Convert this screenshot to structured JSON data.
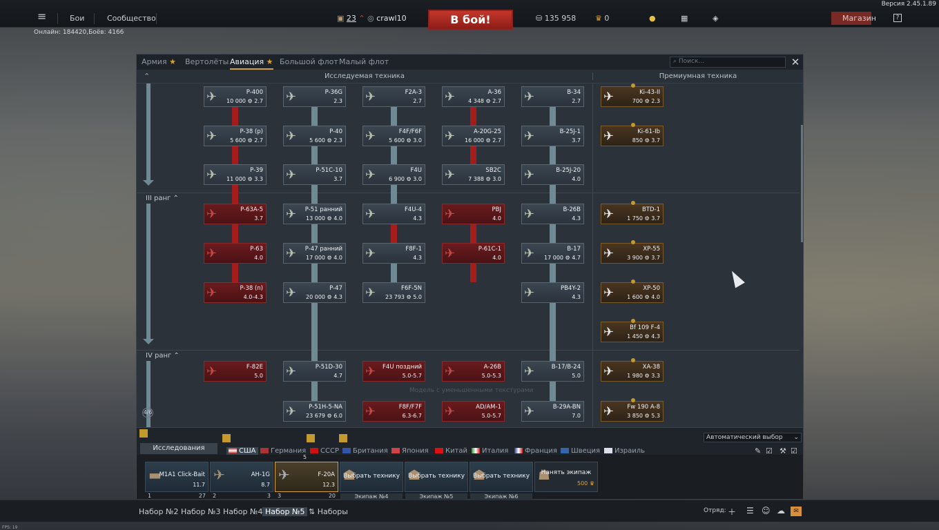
{
  "version": "Версия 2.45.1.89",
  "online": "Онлайн: 184420,Боёв: 4166",
  "fps": "FPS: 19",
  "topbar": {
    "menu": "≡",
    "battles": "Бои",
    "community": "Сообщество",
    "level": "23",
    "player": "crawl10",
    "battle_btn": "В бой!",
    "silver": "135 958",
    "gold": "0",
    "shop": "Магазин",
    "help": "?"
  },
  "tabs": [
    {
      "label": "Армия",
      "star": true
    },
    {
      "label": "Вертолёты",
      "star": false
    },
    {
      "label": "Авиация",
      "star": true,
      "active": true
    },
    {
      "label": "Большой флот",
      "star": false
    },
    {
      "label": "Малый флот",
      "star": false
    }
  ],
  "search_placeholder": "Поиск...",
  "close": "✕",
  "header": {
    "researched": "Исследуемая техника",
    "premium": "Премиумная техника"
  },
  "ranks": [
    "III ранг",
    "IV ранг"
  ],
  "rank_counter": "4/6",
  "overlay_text": "Модель с уменьшенными текстурами",
  "tree": [
    {
      "name": "P-400",
      "stats": "10 000 ⚙ 2.7",
      "type": "gold-top",
      "variant": "grey"
    },
    {
      "name": "P-36G",
      "stats": "2.3",
      "variant": "grey"
    },
    {
      "name": "F2A-3",
      "stats": "2.7",
      "variant": "grey"
    },
    {
      "name": "A-36",
      "stats": "4 348 ⚙ 2.7",
      "variant": "grey"
    },
    {
      "name": "B-34",
      "stats": "2.7",
      "variant": "grey"
    },
    {
      "name": "Ki-43-II",
      "stats": "700 ⚙ 2.3",
      "variant": "gold"
    },
    {
      "name": "P-38 (p)",
      "stats": "5 600 ⚙ 2.7",
      "variant": "grey"
    },
    {
      "name": "P-40",
      "stats": "5 600 ⚙ 2.3",
      "variant": "grey"
    },
    {
      "name": "F4F/F6F",
      "stats": "5 600 ⚙ 3.0",
      "variant": "grey"
    },
    {
      "name": "A-20G-25",
      "stats": "16 000 ⚙ 2.7",
      "variant": "grey"
    },
    {
      "name": "B-25J-1",
      "stats": "3.7",
      "variant": "grey"
    },
    {
      "name": "Ki-61-Ib",
      "stats": "850 ⚙ 3.7",
      "variant": "gold"
    },
    {
      "name": "P-39",
      "stats": "11 000 ⚙ 3.3",
      "variant": "grey"
    },
    {
      "name": "P-51C-10",
      "stats": "3.7",
      "variant": "grey"
    },
    {
      "name": "F4U",
      "stats": "6 900 ⚙ 3.0",
      "variant": "grey"
    },
    {
      "name": "SB2C",
      "stats": "7 388 ⚙ 3.0",
      "variant": "grey"
    },
    {
      "name": "B-25J-20",
      "stats": "4.0",
      "variant": "grey"
    },
    {
      "name": "P-63A-5",
      "stats": "3.7",
      "variant": "red"
    },
    {
      "name": "P-51 ранний",
      "stats": "13 000 ⚙ 4.0",
      "variant": "grey"
    },
    {
      "name": "F4U-4",
      "stats": "4.3",
      "variant": "grey"
    },
    {
      "name": "PBJ",
      "stats": "4.0",
      "variant": "red"
    },
    {
      "name": "B-26B",
      "stats": "4.3",
      "variant": "grey"
    },
    {
      "name": "BTD-1",
      "stats": "1 750 ⚙ 3.7",
      "variant": "gold"
    },
    {
      "name": "P-63",
      "stats": "4.0",
      "variant": "red"
    },
    {
      "name": "P-47 ранний",
      "stats": "17 000 ⚙ 4.0",
      "variant": "grey"
    },
    {
      "name": "F8F-1",
      "stats": "4.3",
      "variant": "grey"
    },
    {
      "name": "P-61C-1",
      "stats": "4.0",
      "variant": "red"
    },
    {
      "name": "B-17",
      "stats": "17 000 ⚙ 4.7",
      "variant": "grey"
    },
    {
      "name": "XP-55",
      "stats": "3 900 ⚙ 3.7",
      "variant": "gold"
    },
    {
      "name": "P-38 (n)",
      "stats": "4.0-4.3",
      "variant": "red"
    },
    {
      "name": "P-47",
      "stats": "20 000 ⚙ 4.3",
      "variant": "grey"
    },
    {
      "name": "F6F-5N",
      "stats": "23 793 ⚙ 5.0",
      "variant": "grey"
    },
    {
      "name": "PB4Y-2",
      "stats": "4.3",
      "variant": "grey"
    },
    {
      "name": "XP-50",
      "stats": "1 600 ⚙ 4.0",
      "variant": "gold"
    },
    {
      "name": "Bf 109 F-4",
      "stats": "1 450 ⚙ 4.3",
      "variant": "gold"
    },
    {
      "name": "F-82E",
      "stats": "5.0",
      "variant": "red"
    },
    {
      "name": "P-51D-30",
      "stats": "4.7",
      "variant": "grey"
    },
    {
      "name": "F4U поздний",
      "stats": "5.0-5.7",
      "variant": "red"
    },
    {
      "name": "A-26B",
      "stats": "5.0-5.3",
      "variant": "red"
    },
    {
      "name": "B-17/B-24",
      "stats": "5.0",
      "variant": "grey"
    },
    {
      "name": "XA-38",
      "stats": "1 980 ⚙ 3.3",
      "variant": "gold"
    },
    {
      "name": "P-51H-5-NA",
      "stats": "23 679 ⚙ 6.0",
      "variant": "grey"
    },
    {
      "name": "F8F/F7F",
      "stats": "6.3-6.7",
      "variant": "red"
    },
    {
      "name": "AD/AM-1",
      "stats": "5.0-5.7",
      "variant": "red"
    },
    {
      "name": "B-29A-BN",
      "stats": "7.0",
      "variant": "grey"
    },
    {
      "name": "Fw 190 A-8",
      "stats": "3 850 ⚙ 5.3",
      "variant": "gold"
    }
  ],
  "nations": {
    "research": "Исследования",
    "auto": "Автоматический выбор",
    "list": [
      "США",
      "Германия",
      "СССР",
      "Британия",
      "Япония",
      "Китай",
      "Италия",
      "Франция",
      "Швеция",
      "Израиль"
    ]
  },
  "crew": [
    {
      "name": "M1A1 Click-Bait",
      "stats": "11.7",
      "num": "1",
      "pts": "27"
    },
    {
      "name": "AH-1G",
      "stats": "8.7",
      "num": "2",
      "pts": "3"
    },
    {
      "name": "F-20A",
      "stats": "12.3",
      "num": "3",
      "pts": "20",
      "sel": true,
      "top": "5"
    },
    {
      "pick": "Выбрать технику",
      "crew": "Экипаж №4"
    },
    {
      "pick": "Выбрать технику",
      "crew": "Экипаж №5"
    },
    {
      "pick": "Выбрать технику",
      "crew": "Экипаж №6"
    },
    {
      "pick": "Нанять экипаж",
      "price": "500"
    }
  ],
  "bottom": {
    "presets": [
      "Набор №2",
      "Набор №3",
      "Набор №4",
      "Набор №5"
    ],
    "sets": "Наборы",
    "squad": "Отряд:"
  }
}
